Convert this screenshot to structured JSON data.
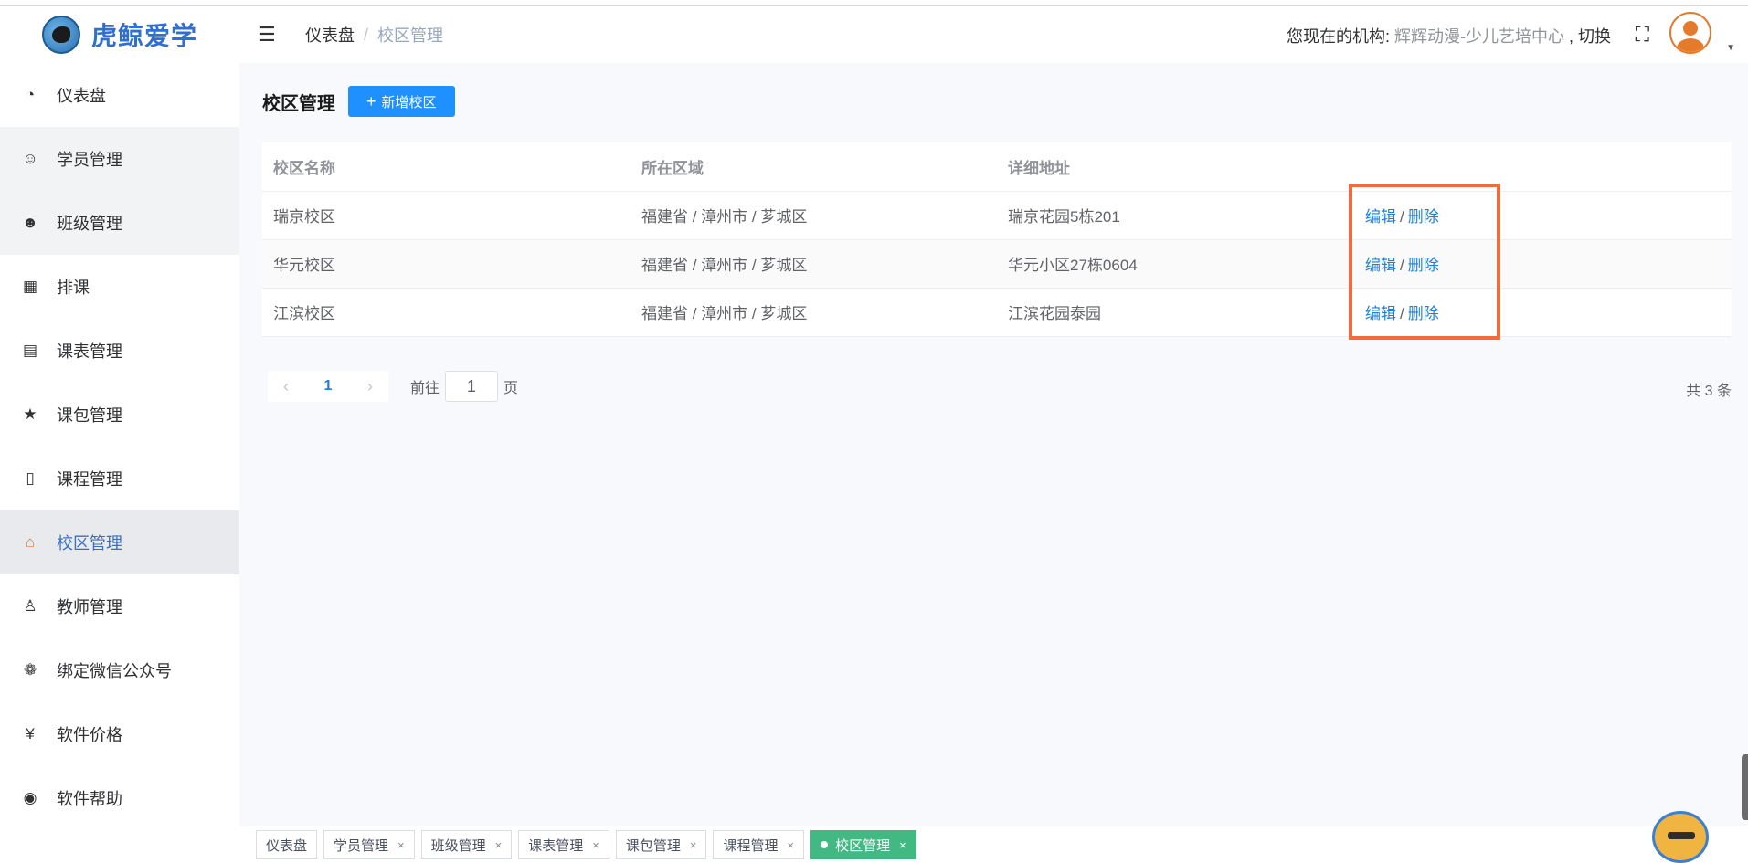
{
  "app": {
    "logo_text": "虎鲸爱学"
  },
  "sidebar": {
    "items": [
      {
        "label": "仪表盘",
        "icon": "dashboard-icon",
        "glyph": "◔"
      },
      {
        "label": "学员管理",
        "icon": "chat-icon",
        "glyph": "☺"
      },
      {
        "label": "班级管理",
        "icon": "users-icon",
        "glyph": "☻"
      },
      {
        "label": "排课",
        "icon": "calendar-icon",
        "glyph": "▦"
      },
      {
        "label": "课表管理",
        "icon": "table-icon",
        "glyph": "▤"
      },
      {
        "label": "课包管理",
        "icon": "star-icon",
        "glyph": "★"
      },
      {
        "label": "课程管理",
        "icon": "book-icon",
        "glyph": "▯"
      },
      {
        "label": "校区管理",
        "icon": "shop-icon",
        "glyph": "⌂"
      },
      {
        "label": "教师管理",
        "icon": "teacher-icon",
        "glyph": "♙"
      },
      {
        "label": "绑定微信公众号",
        "icon": "wechat-icon",
        "glyph": "❁"
      },
      {
        "label": "软件价格",
        "icon": "yen-icon",
        "glyph": "¥"
      },
      {
        "label": "软件帮助",
        "icon": "globe-icon",
        "glyph": "◉"
      }
    ]
  },
  "header": {
    "breadcrumb_home": "仪表盘",
    "breadcrumb_sep": "/",
    "breadcrumb_current": "校区管理",
    "org_prefix": "您现在的机构: ",
    "org_name": "辉辉动漫-少儿艺培中心",
    "org_switch": " , 切换"
  },
  "main": {
    "title": "校区管理",
    "add_button": "新增校区",
    "columns": [
      "校区名称",
      "所在区域",
      "详细地址",
      ""
    ],
    "rows": [
      {
        "name": "瑞京校区",
        "region": "福建省 / 漳州市 / 芗城区",
        "address": "瑞京花园5栋201"
      },
      {
        "name": "华元校区",
        "region": "福建省 / 漳州市 / 芗城区",
        "address": "华元小区27栋0604"
      },
      {
        "name": "江滨校区",
        "region": "福建省 / 漳州市 / 芗城区",
        "address": "江滨花园泰园"
      }
    ],
    "op_edit": "编辑",
    "op_delete": "删除",
    "op_sep": "/"
  },
  "pagination": {
    "current_page": "1",
    "goto_label": "前往",
    "goto_value": "1",
    "page_suffix": "页",
    "total": "共 3 条"
  },
  "tags": [
    {
      "label": "仪表盘",
      "closable": false,
      "active": false
    },
    {
      "label": "学员管理",
      "closable": true,
      "active": false
    },
    {
      "label": "班级管理",
      "closable": true,
      "active": false
    },
    {
      "label": "课表管理",
      "closable": true,
      "active": false
    },
    {
      "label": "课包管理",
      "closable": true,
      "active": false
    },
    {
      "label": "课程管理",
      "closable": true,
      "active": false
    },
    {
      "label": "校区管理",
      "closable": true,
      "active": true
    }
  ],
  "colors": {
    "accent": "#1e90ff",
    "active_tag": "#42b983",
    "highlight": "#f26b3a"
  }
}
